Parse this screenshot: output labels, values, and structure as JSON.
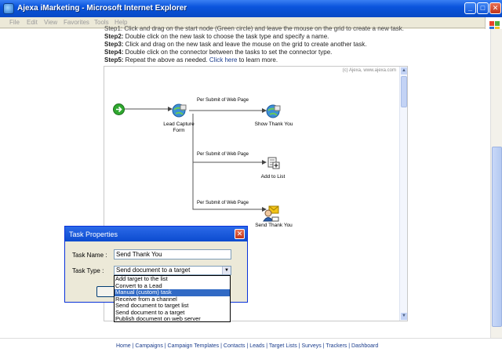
{
  "window": {
    "title": "Ajexa iMarketing - Microsoft Internet Explorer"
  },
  "menu": [
    "File",
    "Edit",
    "View",
    "Favorites",
    "Tools",
    "Help"
  ],
  "steps": {
    "step1_partial": "Step1: Click and drag on the start node (Green circle) and leave the mouse on the grid to create a new task.",
    "step2_label": "Step2:",
    "step2_text": " Double click on the new task to choose the task type and specify a name.",
    "step3_label": "Step3:",
    "step3_text": " Click and drag on the new task and leave the mouse on the grid to create another task.",
    "step4_label": "Step4:",
    "step4_text": " Double click on the connector between the tasks to set the connector type.",
    "step5_label": "Step5:",
    "step5_text": " Repeat the above as needed.",
    "step5_link": "Click here",
    "step5_tail": " to learn more."
  },
  "canvas": {
    "copyright": "(c) Ajexa, www.ajexa.com",
    "nodes": [
      {
        "label": "Lead Capture\nForm"
      },
      {
        "label": "Show Thank You"
      },
      {
        "label": "Add to List"
      },
      {
        "label": "Send Thank You"
      }
    ],
    "edges": [
      "Per Submit of Web Page",
      "Per Submit of Web Page",
      "Per Submit of Web Page"
    ]
  },
  "dialog": {
    "title": "Task Properties",
    "name_label": "Task Name :",
    "name_value": "Send Thank You",
    "type_label": "Task Type :",
    "type_value": "Send document to a target",
    "options": [
      "Add target to the list",
      "Convert to a Lead",
      "Manual (custom) task",
      "Receive from a channel",
      "Send document to target list",
      "Send document to a target",
      "Publish document on web server"
    ],
    "selected_option_index": 2
  },
  "footer": {
    "links": [
      "Home",
      "Campaigns",
      "Campaign Templates",
      "Contacts",
      "Leads",
      "Target Lists",
      "Surveys",
      "Trackers",
      "Dashboard"
    ],
    "separator": " | "
  },
  "colors": {
    "titlebar": "#0a54dc",
    "selection": "#316ac5",
    "start_node": "#2fa82f"
  }
}
